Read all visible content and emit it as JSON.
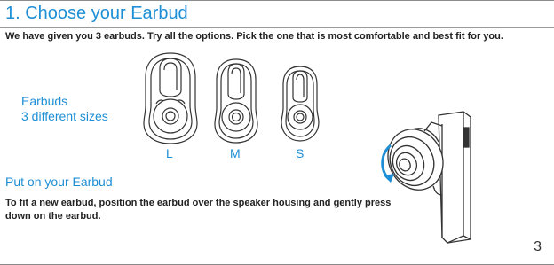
{
  "heading": "1. Choose your Earbud",
  "intro": "We have given you 3 earbuds. Try all the options. Pick the one that is most comfortable and best fit for you.",
  "sizes_label": {
    "line1": "Earbuds",
    "line2": "3 different sizes"
  },
  "sizes": [
    "L",
    "M",
    "S"
  ],
  "section_heading": "Put on your Earbud",
  "instructions": "To fit a new earbud, position the earbud over the speaker housing and gently press down on the earbud.",
  "page_number": "3",
  "colors": {
    "accent": "#1e8fd6",
    "text": "#222222",
    "line": "#333333"
  }
}
